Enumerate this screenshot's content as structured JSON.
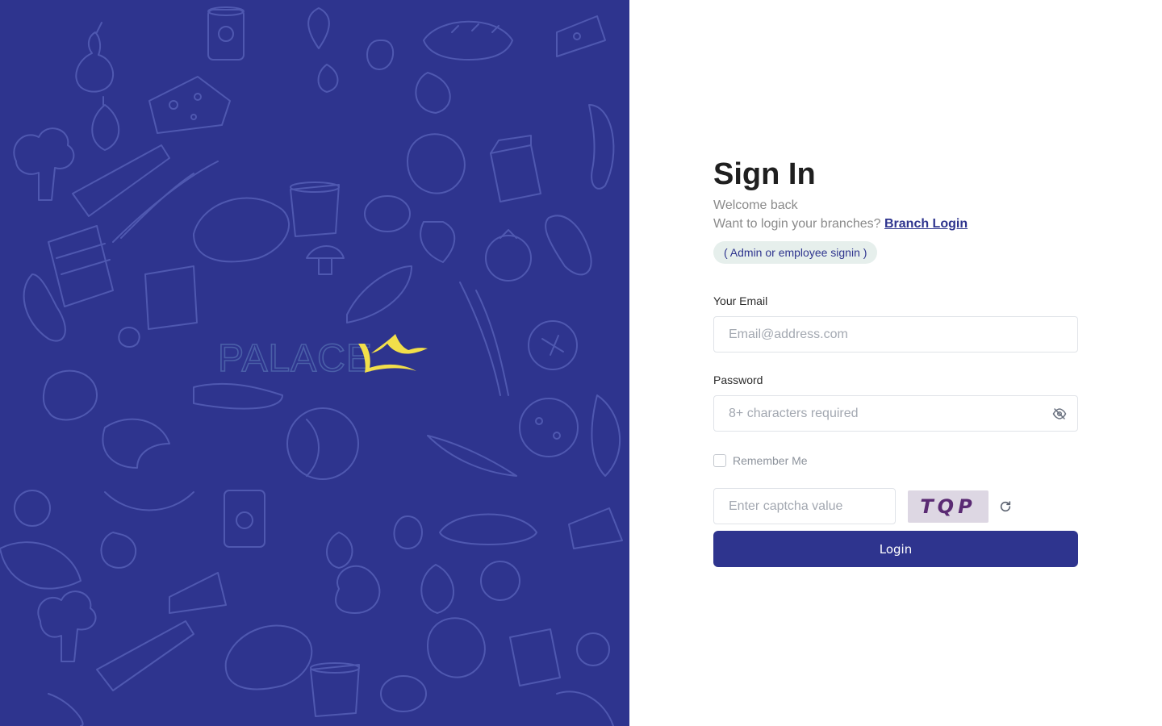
{
  "brand": {
    "logo_text": "PALACE",
    "background_color": "#2e348e",
    "logo_text_color": "#4a5fa8",
    "logo_crown_color": "#f2df4a",
    "pattern_icon": "grocery-doodle-pattern"
  },
  "form": {
    "title": "Sign In",
    "welcome_text": "Welcome back",
    "branch_prompt": "Want to login your branches?",
    "branch_link_label": "Branch Login",
    "role_badge": "( Admin or employee signin )",
    "email": {
      "label": "Your Email",
      "placeholder": "Email@address.com",
      "value": ""
    },
    "password": {
      "label": "Password",
      "placeholder": "8+ characters required",
      "value": "",
      "toggle_icon": "eye-off-icon"
    },
    "remember_me": {
      "label": "Remember Me",
      "checked": false
    },
    "captcha": {
      "placeholder": "Enter captcha value",
      "value": "",
      "code": "TQP",
      "refresh_icon": "refresh-icon"
    },
    "login_button_label": "Login",
    "accent_color": "#2e348e"
  }
}
